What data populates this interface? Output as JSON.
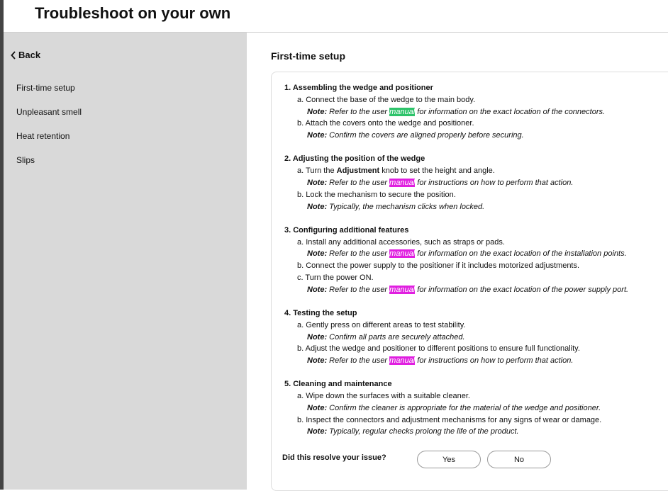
{
  "header": {
    "title": "Troubleshoot on your own"
  },
  "sidebar": {
    "back_label": "Back",
    "items": [
      {
        "label": "First-time setup"
      },
      {
        "label": "Unpleasant smell"
      },
      {
        "label": "Heat retention"
      },
      {
        "label": "Slips"
      }
    ]
  },
  "main": {
    "title": "First-time setup",
    "steps": [
      {
        "title": "1. Assembling the wedge and positioner",
        "subs": [
          {
            "text": "a. Connect the base of the wedge to the main body.",
            "note": {
              "label": "Note:",
              "before": " Refer to the user ",
              "highlight": "manual",
              "highlight_color": "green",
              "after": " for information on the exact location of the connectors."
            }
          },
          {
            "text": "b. Attach the covers onto the wedge and positioner.",
            "note": {
              "label": "Note:",
              "before": " Confirm the covers are aligned properly before securing."
            }
          }
        ]
      },
      {
        "title": "2. Adjusting the position of the wedge",
        "subs": [
          {
            "text_parts": {
              "before": "a. Turn the ",
              "bold": "Adjustment",
              "after": " knob to set the height and angle."
            },
            "note": {
              "label": "Note:",
              "before": " Refer to the user ",
              "highlight": "manual",
              "highlight_color": "magenta",
              "after": " for instructions on how to perform that action."
            }
          },
          {
            "text": "b. Lock the mechanism to secure the position.",
            "note": {
              "label": "Note:",
              "before": " Typically, the mechanism clicks when locked."
            }
          }
        ]
      },
      {
        "title": "3. Configuring additional features",
        "subs": [
          {
            "text": "a. Install any additional accessories, such as straps or pads.",
            "note": {
              "label": "Note:",
              "before": " Refer to the user ",
              "highlight": "manual",
              "highlight_color": "magenta",
              "after": " for information on the exact location of the installation points."
            }
          },
          {
            "text": "b. Connect the power supply to the positioner if it includes motorized adjustments."
          },
          {
            "text": "c. Turn the power ON.",
            "note": {
              "label": "Note:",
              "before": " Refer to the user ",
              "highlight": "manual",
              "highlight_color": "magenta",
              "after": " for information on the exact location of the power supply port."
            }
          }
        ]
      },
      {
        "title": "4. Testing the setup",
        "subs": [
          {
            "text": "a. Gently press on different areas to test stability.",
            "note": {
              "label": "Note:",
              "before": " Confirm all parts are securely attached."
            }
          },
          {
            "text": "b. Adjust the wedge and positioner to different positions to ensure full functionality.",
            "note": {
              "label": "Note:",
              "before": " Refer to the user ",
              "highlight": "manual",
              "highlight_color": "magenta",
              "after": " for instructions on how to perform that action."
            }
          }
        ]
      },
      {
        "title": "5. Cleaning and maintenance",
        "subs": [
          {
            "text": "a. Wipe down the surfaces with a suitable cleaner.",
            "note": {
              "label": "Note:",
              "before": " Confirm the cleaner is appropriate for the material of the wedge and positioner."
            }
          },
          {
            "text": "b. Inspect the connectors and adjustment mechanisms for any signs of wear or damage.",
            "note": {
              "label": "Note:",
              "before": " Typically, regular checks prolong the life of the product."
            }
          }
        ]
      }
    ],
    "feedback": {
      "question": "Did this resolve your issue?",
      "yes_label": "Yes",
      "no_label": "No"
    }
  },
  "colors": {
    "sidebar_bg": "#d9d9d9",
    "highlight_green": "#2dc36a",
    "highlight_magenta": "#e01fe0"
  }
}
